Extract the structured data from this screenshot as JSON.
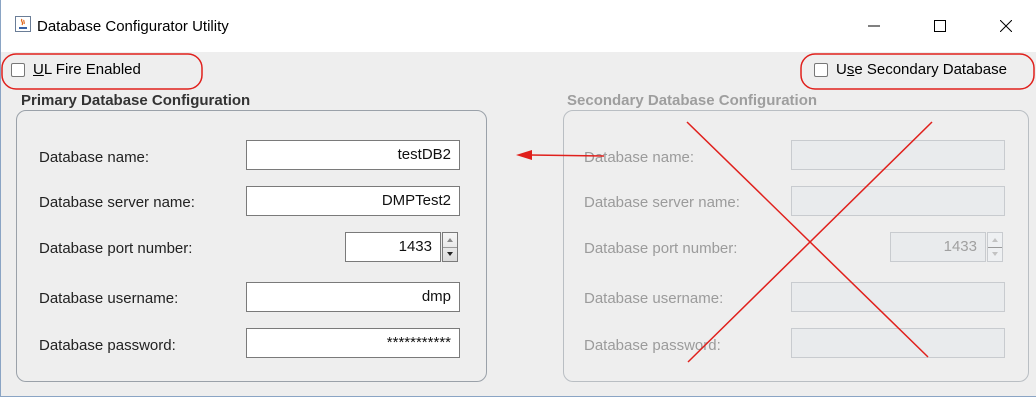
{
  "window": {
    "title": "Database Configurator Utility",
    "controls": [
      "minimize",
      "maximize",
      "close"
    ]
  },
  "checkboxes": {
    "ul_fire": {
      "label_underlined": "U",
      "label_rest": "L Fire Enabled",
      "checked": false
    },
    "use_secondary": {
      "label_prefix": "U",
      "label_underlined": "s",
      "label_rest": "e Secondary Database",
      "checked": false
    }
  },
  "primary": {
    "title": "Primary Database Configuration",
    "fields": [
      {
        "label": "Database name:",
        "value": "testDB2"
      },
      {
        "label": "Database server name:",
        "value": "DMPTest2"
      },
      {
        "label": "Database port number:",
        "value": "1433"
      },
      {
        "label": "Database username:",
        "value": "dmp"
      },
      {
        "label": "Database password:",
        "value": "***********"
      }
    ]
  },
  "secondary": {
    "title": "Secondary Database Configuration",
    "fields": [
      {
        "label": "Database name:",
        "value": ""
      },
      {
        "label": "Database server name:",
        "value": ""
      },
      {
        "label": "Database port number:",
        "value": "1433"
      },
      {
        "label": "Database username:",
        "value": ""
      },
      {
        "label": "Database password:",
        "value": ""
      }
    ]
  },
  "annotation_color": "#e0201c"
}
